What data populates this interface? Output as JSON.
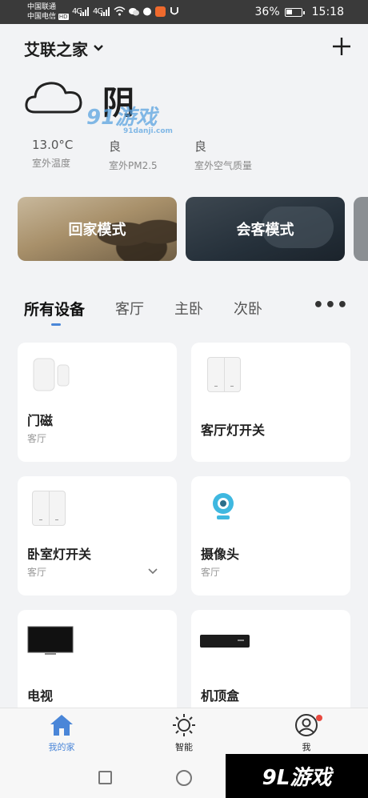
{
  "status_bar": {
    "carrier1": "中国联通",
    "carrier2": "中国电信",
    "carrier2_badge": "HD",
    "signal1": "4G",
    "signal2": "4G",
    "battery": "36%",
    "time": "15:18"
  },
  "header": {
    "home_name": "艾联之家",
    "chevron": "⌄",
    "add_symbol": "+"
  },
  "weather": {
    "condition": "阴",
    "icon": "cloud-icon",
    "stats": [
      {
        "value": "13.0°C",
        "label": "室外温度"
      },
      {
        "value": "良",
        "label": "室外PM2.5"
      },
      {
        "value": "良",
        "label": "室外空气质量"
      }
    ]
  },
  "watermark": {
    "big": "91游戏",
    "small": "91danji.com"
  },
  "scenes": [
    {
      "label": "回家模式"
    },
    {
      "label": "会客模式"
    }
  ],
  "tabs": [
    {
      "label": "所有设备",
      "active": true
    },
    {
      "label": "客厅",
      "active": false
    },
    {
      "label": "主卧",
      "active": false
    },
    {
      "label": "次卧",
      "active": false
    }
  ],
  "more_symbol": "•••",
  "devices": [
    {
      "name": "门磁",
      "room": "客厅",
      "icon": "door-sensor-icon"
    },
    {
      "name": "客厅灯开关",
      "room": "",
      "icon": "wall-switch-icon"
    },
    {
      "name": "卧室灯开关",
      "room": "客厅",
      "icon": "wall-switch-icon"
    },
    {
      "name": "摄像头",
      "room": "客厅",
      "icon": "camera-icon"
    },
    {
      "name": "电视",
      "room": "",
      "icon": "tv-icon"
    },
    {
      "name": "机顶盒",
      "room": "",
      "icon": "set-top-box-icon"
    }
  ],
  "bottom_nav": [
    {
      "label": "我的家",
      "icon": "home-icon",
      "active": true
    },
    {
      "label": "智能",
      "icon": "sun-icon",
      "active": false
    },
    {
      "label": "我",
      "icon": "profile-icon",
      "active": false
    }
  ],
  "brand_badge": "9L游戏",
  "colors": {
    "accent": "#4a86d8",
    "background": "#f2f3f5",
    "notification": "#e8493f"
  }
}
